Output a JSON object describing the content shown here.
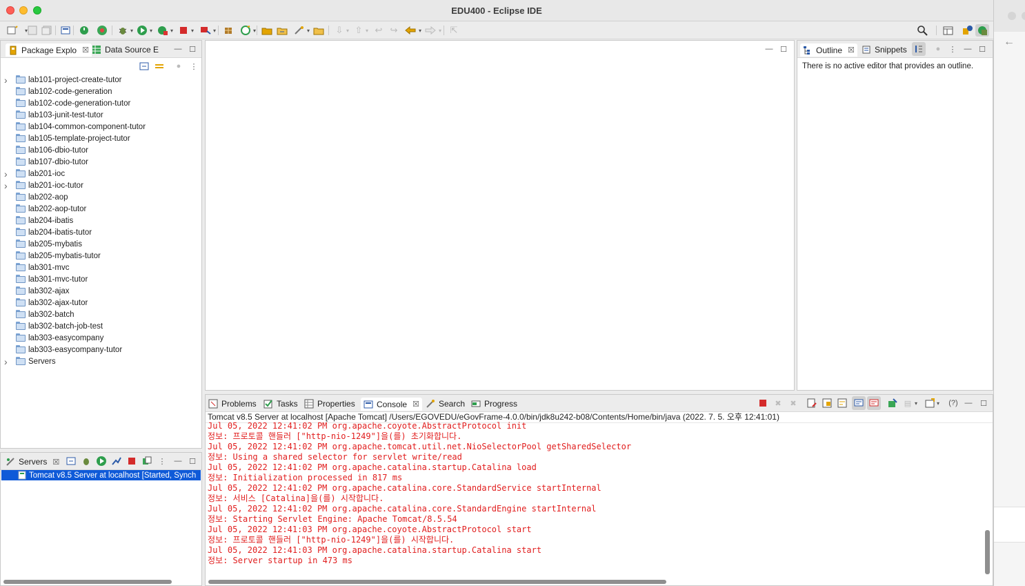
{
  "window": {
    "title": "EDU400 - Eclipse IDE"
  },
  "toolbar": {
    "icons": [
      "new-icon",
      "save-icon",
      "save-all-icon",
      "terminal-icon",
      "power-icon",
      "refresh-icon",
      "debug-icon",
      "run-icon",
      "coverage-icon",
      "stop-icon",
      "external-tools-icon",
      "new-java-icon",
      "new-class-icon",
      "open-type-icon",
      "open-task-icon",
      "search-icon",
      "next-annotation-icon",
      "prev-annotation-icon",
      "back-icon",
      "forward-icon",
      "last-edit-icon",
      "pin-icon",
      "search-global-icon",
      "perspective-open-icon",
      "perspective-java-icon",
      "perspective-jee-icon"
    ]
  },
  "package_explorer": {
    "tab_label": "Package Explo",
    "tab2_label": "Data Source E",
    "items": [
      {
        "label": "lab101-project-create-tutor",
        "expandable": true
      },
      {
        "label": "lab102-code-generation",
        "expandable": false
      },
      {
        "label": "lab102-code-generation-tutor",
        "expandable": false
      },
      {
        "label": "lab103-junit-test-tutor",
        "expandable": false
      },
      {
        "label": "lab104-common-component-tutor",
        "expandable": false
      },
      {
        "label": "lab105-template-project-tutor",
        "expandable": false
      },
      {
        "label": "lab106-dbio-tutor",
        "expandable": false
      },
      {
        "label": "lab107-dbio-tutor",
        "expandable": false
      },
      {
        "label": "lab201-ioc",
        "expandable": true
      },
      {
        "label": "lab201-ioc-tutor",
        "expandable": true
      },
      {
        "label": "lab202-aop",
        "expandable": false
      },
      {
        "label": "lab202-aop-tutor",
        "expandable": false
      },
      {
        "label": "lab204-ibatis",
        "expandable": false
      },
      {
        "label": "lab204-ibatis-tutor",
        "expandable": false
      },
      {
        "label": "lab205-mybatis",
        "expandable": false
      },
      {
        "label": "lab205-mybatis-tutor",
        "expandable": false
      },
      {
        "label": "lab301-mvc",
        "expandable": false
      },
      {
        "label": "lab301-mvc-tutor",
        "expandable": false
      },
      {
        "label": "lab302-ajax",
        "expandable": false
      },
      {
        "label": "lab302-ajax-tutor",
        "expandable": false
      },
      {
        "label": "lab302-batch",
        "expandable": false
      },
      {
        "label": "lab302-batch-job-test",
        "expandable": false
      },
      {
        "label": "lab303-easycompany",
        "expandable": false
      },
      {
        "label": "lab303-easycompany-tutor",
        "expandable": false
      },
      {
        "label": "Servers",
        "expandable": true
      }
    ]
  },
  "servers_view": {
    "tab_label": "Servers",
    "server_label": "Tomcat v8.5 Server at localhost  [Started, Synch"
  },
  "outline": {
    "tab_label": "Outline",
    "tab2_label": "Snippets",
    "message": "There is no active editor that provides an outline."
  },
  "bottom_panel": {
    "tabs": [
      "Problems",
      "Tasks",
      "Properties",
      "Console",
      "Search",
      "Progress"
    ],
    "active_tab": "Console",
    "console_header": "Tomcat v8.5 Server at localhost [Apache Tomcat] /Users/EGOVEDU/eGovFrame-4.0.0/bin/jdk8u242-b08/Contents/Home/bin/java  (2022. 7. 5. 오후 12:41:01)",
    "lines": [
      "Jul 05, 2022 12:41:02 PM org.apache.coyote.AbstractProtocol init",
      "정보: 프로토콜 핸들러 [\"http-nio-1249\"]을(를) 초기화합니다.",
      "Jul 05, 2022 12:41:02 PM org.apache.tomcat.util.net.NioSelectorPool getSharedSelector",
      "정보: Using a shared selector for servlet write/read",
      "Jul 05, 2022 12:41:02 PM org.apache.catalina.startup.Catalina load",
      "정보: Initialization processed in 817 ms",
      "Jul 05, 2022 12:41:02 PM org.apache.catalina.core.StandardService startInternal",
      "정보: 서비스 [Catalina]을(를) 시작합니다.",
      "Jul 05, 2022 12:41:02 PM org.apache.catalina.core.StandardEngine startInternal",
      "정보: Starting Servlet Engine: Apache Tomcat/8.5.54",
      "Jul 05, 2022 12:41:03 PM org.apache.coyote.AbstractProtocol start",
      "정보: 프로토콜 핸들러 [\"http-nio-1249\"]을(를) 시작합니다.",
      "Jul 05, 2022 12:41:03 PM org.apache.catalina.startup.Catalina start",
      "정보: Server startup in 473 ms"
    ]
  },
  "colors": {
    "console_text": "#e11d1d",
    "selection": "#0f5ad8"
  }
}
